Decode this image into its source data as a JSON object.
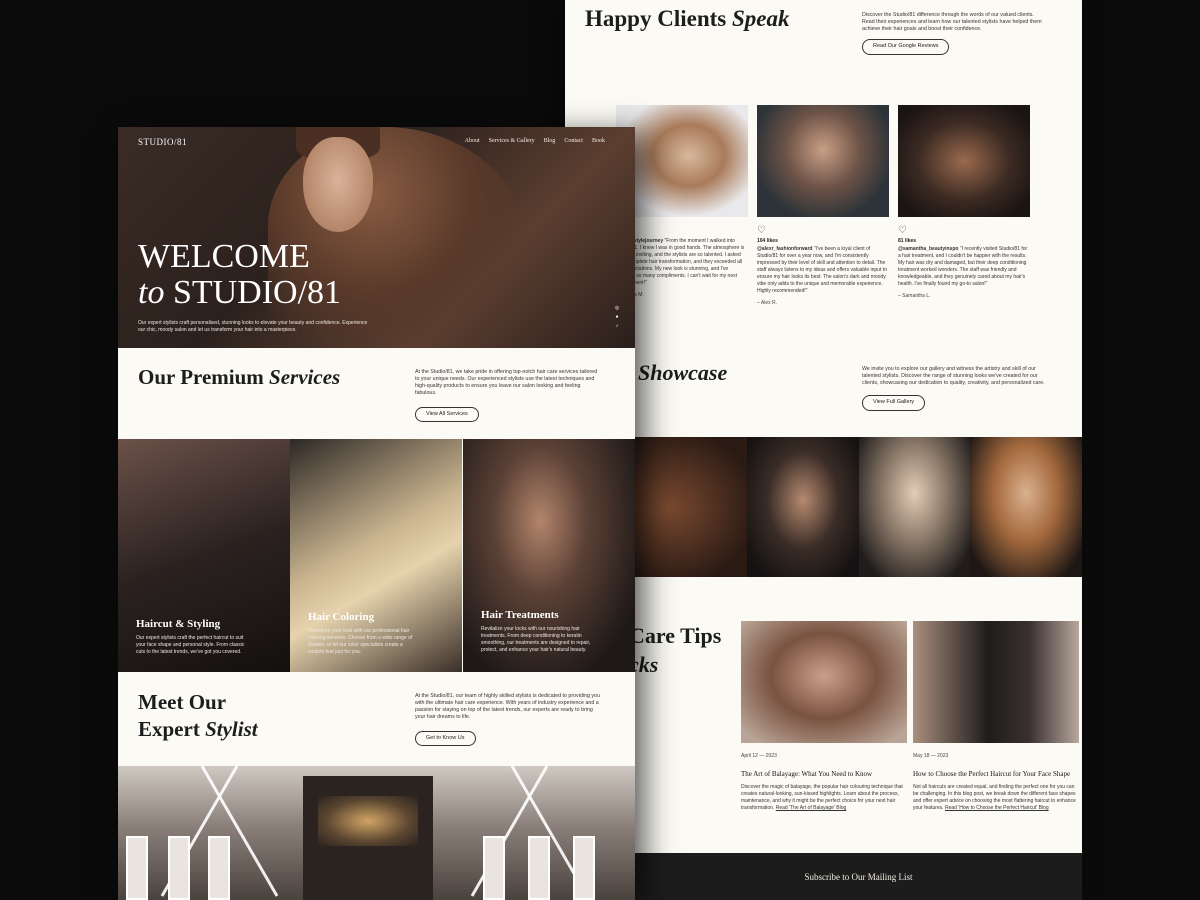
{
  "back_page": {
    "testimonials": {
      "heading_main": "Happy Clients ",
      "heading_em": "Speak",
      "intro": "Discover the Studio/81 difference through the words of our valued clients. Read their experiences and learn how our talented stylists have helped them achieve their hair goals and boost their confidence.",
      "button": "Read Our Google Reviews",
      "cards": [
        {
          "likes": "",
          "handle": "@cam_stylejourney",
          "text": " \"From the moment I walked into Studio/81, I knew I was in good hands. The atmosphere is chic and inviting, and the stylists are so talented. I asked for a complete hair transformation, and they exceeded all my expectations. My new look is stunning, and I've received so many compliments. I can't wait for my next appointment!\"",
          "signature": "– Jessica M."
        },
        {
          "likes": "104 likes",
          "handle": "@alexr_fashionforward",
          "text": " \"I've been a loyal client of Studio/81 for over a year now, and I'm consistently impressed by their level of skill and attention to detail. The staff always listens to my ideas and offers valuable input to ensure my hair looks its best. The salon's dark and moody vibe only adds to the unique and memorable experience. Highly recommended!\"",
          "signature": "– Alex R."
        },
        {
          "likes": "81 likes",
          "handle": "@samantha_beautyinspo",
          "text": " \"I recently visited Studio/81 for a hair treatment, and I couldn't be happier with the results. My hair was dry and damaged, but their deep conditioning treatment worked wonders. The staff was friendly and knowledgeable, and they genuinely cared about my hair's health. I've finally found my go-to salon!\"",
          "signature": "– Samantha L."
        }
      ]
    },
    "gallery": {
      "heading": "Showcase",
      "intro": "We invite you to explore our gallery and witness the artistry and skill of our talented stylists. Discover the range of stunning looks we've created for our clients, showcasing our dedication to quality, creativity, and personalized care.",
      "button": "View Full Gallery"
    },
    "tips": {
      "heading_line1": "Care Tips",
      "heading_line2": "cks",
      "posts": [
        {
          "date": "April 12 — 2023",
          "title": "The Art of Balayage: What You Need to Know",
          "text": "Discover the magic of balayage, the popular hair colouring technique that creates natural-looking, sun-kissed highlights. Learn about the process, maintenance, and why it might be the perfect choice for your next hair transformation. ",
          "link": "Read 'The Art of Balayage' Blog"
        },
        {
          "date": "May 18 — 2023",
          "title": "How to Choose the Perfect Haircut for Your Face Shape",
          "text": "Not all haircuts are created equal, and finding the perfect one for you can be challenging. In this blog post, we break down the different face shapes and offer expert advice on choosing the most flattering haircut to enhance your features. ",
          "link": "Read 'How to Choose the Perfect Haircut' Blog"
        }
      ]
    },
    "mailing": "Subscribe to Our Mailing List"
  },
  "front_page": {
    "logo": "STUDIO/81",
    "nav": [
      "About",
      "Services & Gallery",
      "Blog",
      "Contact",
      "Book"
    ],
    "hero": {
      "line1": "WELCOME",
      "line2_em": "to",
      "line2_rest": " STUDIO/81",
      "text": "Our expert stylists craft personalised, stunning looks to elevate your beauty and confidence. Experience our chic, moody salon and let us transform your hair into a masterpiece.",
      "social_icons": [
        "instagram-icon",
        "facebook-icon",
        "tiktok-icon"
      ]
    },
    "services": {
      "heading_main": "Our Premium ",
      "heading_em": "Services",
      "intro": "At the Studio/81, we take pride in offering top-notch hair care services tailored to your unique needs. Our experienced stylists use the latest techniques and high-quality products to ensure you leave our salon looking and feeling fabulous.",
      "button": "View All Services",
      "items": [
        {
          "title": "Haircut & Styling",
          "text": "Our expert stylists craft the perfect haircut to suit your face shape and personal style. From classic cuts to the latest trends, we've got you covered."
        },
        {
          "title": "Hair Coloring",
          "text": "Transform your look with our professional hair coloring services. Choose from a wide range of shades, or let our color specialists create a custom hue just for you."
        },
        {
          "title": "Hair Treatments",
          "text": "Revitalize your locks with our nourishing hair treatments. From deep conditioning to keratin smoothing, our treatments are designed to repair, protect, and enhance your hair's natural beauty."
        }
      ]
    },
    "stylist": {
      "heading_line1": "Meet Our",
      "heading_line2_main": "Expert ",
      "heading_line2_em": "Stylist",
      "intro": "At the Studio/81, our team of highly skilled stylists is dedicated to providing you with the ultimate hair care experience. With years of industry experience and a passion for staying on top of the latest trends, our experts are ready to bring your hair dreams to life.",
      "button": "Get to Know Us"
    }
  },
  "colors": {
    "background": "#0b0b0b",
    "cream": "#fcfaf4",
    "dark_footer": "#1c1c1c"
  }
}
